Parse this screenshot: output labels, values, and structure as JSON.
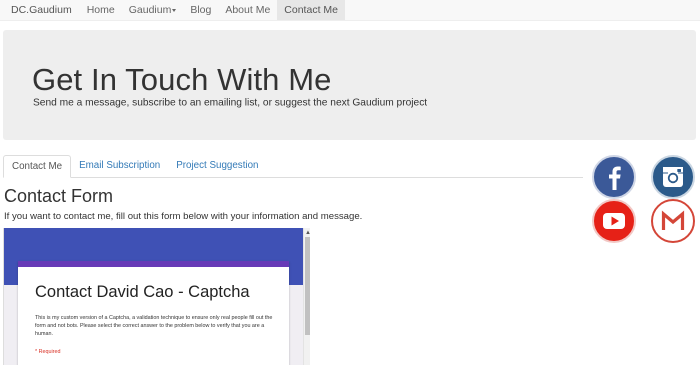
{
  "navbar": {
    "brand": "DC.Gaudium",
    "items": [
      {
        "label": "Home"
      },
      {
        "label": "Gaudium"
      },
      {
        "label": "Blog"
      },
      {
        "label": "About Me"
      },
      {
        "label": "Contact Me",
        "active": true
      }
    ]
  },
  "hero": {
    "title": "Get In Touch With Me",
    "subtitle": "Send me a message, subscribe to an emailing list, or suggest the next Gaudium project"
  },
  "tabs": [
    {
      "label": "Contact Me",
      "active": true
    },
    {
      "label": "Email Subscription"
    },
    {
      "label": "Project Suggestion"
    }
  ],
  "contact": {
    "title": "Contact Form",
    "description": "If you want to contact me, fill out this form below with your information and message."
  },
  "embedded_form": {
    "title": "Contact David Cao - Captcha",
    "body": "This is my custom version of a Captcha, a validation technique to ensure only real people fill out the form and not bots. Please select the correct answer to the problem below to verify that you are a human.",
    "required_note": "* Required"
  },
  "social": [
    {
      "icon": "facebook-icon",
      "color": "#3b5998"
    },
    {
      "icon": "instagram-icon",
      "color": "#2b5a8a"
    },
    {
      "icon": "youtube-icon",
      "color": "#e62117"
    },
    {
      "icon": "gmail-icon",
      "color": "#d44638"
    }
  ],
  "colors": {
    "form_header": "#3f51b5",
    "form_accent": "#673ab7",
    "link": "#337ab7"
  }
}
